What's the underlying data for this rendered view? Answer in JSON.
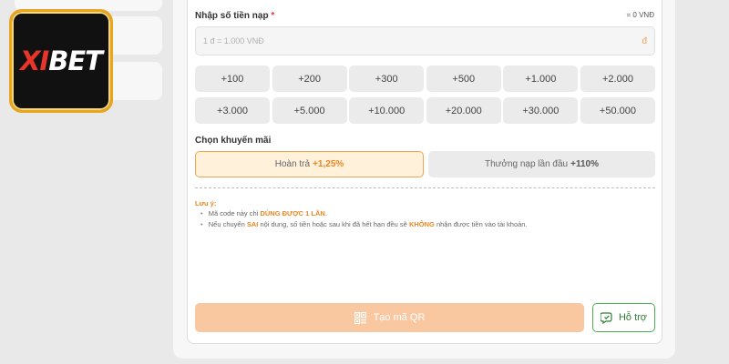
{
  "logo": {
    "text_x": "XI",
    "text_rest": "BET"
  },
  "form": {
    "amount_label": "Nhập số tiền nạp",
    "required_mark": "*",
    "total": "= 0 VNĐ",
    "amount_placeholder": "1 đ = 1.000 VNĐ",
    "currency_symbol": "đ"
  },
  "amounts": [
    "+100",
    "+200",
    "+300",
    "+500",
    "+1.000",
    "+2.000",
    "+3.000",
    "+5.000",
    "+10.000",
    "+20.000",
    "+30.000",
    "+50.000"
  ],
  "promo": {
    "label": "Chọn khuyến mãi",
    "option1_text": "Hoàn trả",
    "option1_value": "+1,25%",
    "option2_text": "Thưởng nạp lần đầu",
    "option2_value": "+110%"
  },
  "notes": {
    "title": "Lưu ý:",
    "line1_a": "Mã code này chỉ",
    "line1_b": "DÙNG ĐƯỢC 1 LẦN",
    "line1_c": ".",
    "line2_a": "Nếu chuyển",
    "line2_b": "SAI",
    "line2_c": "nội dung, số tiền hoặc sau khi đã hết hạn đều sẽ",
    "line2_d": "KHÔNG",
    "line2_e": "nhận được tiền vào tài khoản."
  },
  "actions": {
    "qr_label": "Tạo mã QR",
    "help_label": "Hỗ trợ"
  },
  "colors": {
    "accent": "#e98622",
    "qr_button": "#f9c7a0",
    "help_border": "#4caf50",
    "promo_selected_bg": "#fff1da"
  },
  "icons": {
    "qr": "qr-code-icon",
    "help": "support-chat-icon"
  }
}
